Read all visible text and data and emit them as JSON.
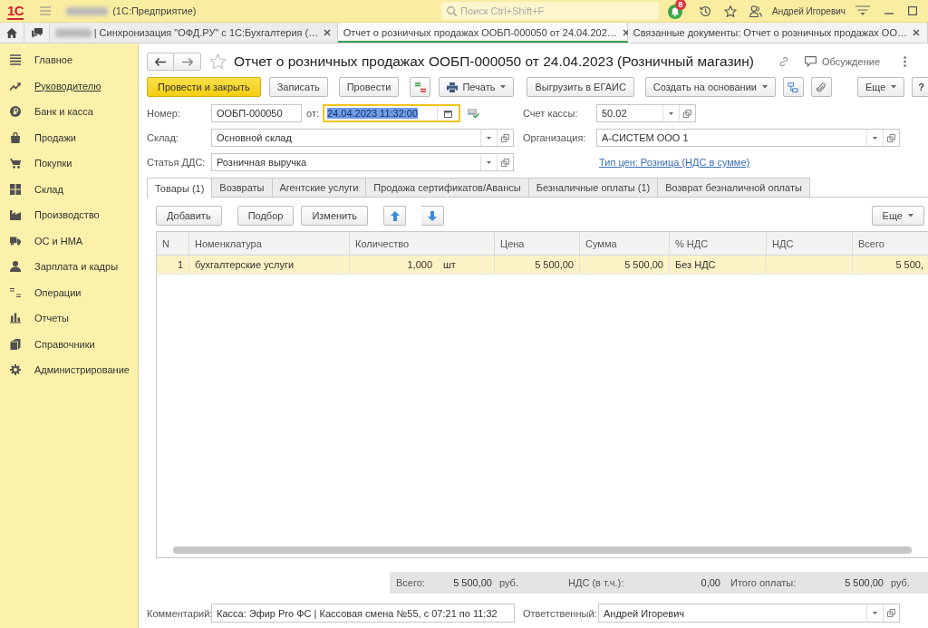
{
  "app_header": {
    "logo": "1С",
    "title_redacted": true,
    "title": "(1С:Предприятие)",
    "search": {
      "placeholder": "Поиск Ctrl+Shift+F"
    },
    "notifications_count": "8",
    "user_name": "Андрей Игоревич"
  },
  "open_tabs": [
    {
      "label": "| Синхронизация \"ОФД.РУ\" с 1С:Бухгалтерия (…",
      "redacted_prefix": true,
      "selected": false
    },
    {
      "label": "Отчет о розничных продажах ООБП-000050 от 24.04.202…",
      "redacted_prefix": false,
      "selected": true
    },
    {
      "label": "Связанные документы: Отчет о розничных продажах ОО…",
      "redacted_prefix": false,
      "selected": false
    }
  ],
  "sidebar": {
    "items": [
      {
        "label": "Главное",
        "hovered": false
      },
      {
        "label": "Руководителю",
        "hovered": true
      },
      {
        "label": "Банк и касса",
        "hovered": false
      },
      {
        "label": "Продажи",
        "hovered": false
      },
      {
        "label": "Покупки",
        "hovered": false
      },
      {
        "label": "Склад",
        "hovered": false
      },
      {
        "label": "Производство",
        "hovered": false
      },
      {
        "label": "ОС и НМА",
        "hovered": false
      },
      {
        "label": "Зарплата и кадры",
        "hovered": false
      },
      {
        "label": "Операции",
        "hovered": false
      },
      {
        "label": "Отчеты",
        "hovered": false
      },
      {
        "label": "Справочники",
        "hovered": false
      },
      {
        "label": "Администрирование",
        "hovered": false
      }
    ]
  },
  "document": {
    "title": "Отчет о розничных продажах ООБП-000050 от 24.04.2023 (Розничный магазин)",
    "discussion": "Обсуждение",
    "toolbar": [
      {
        "kind": "primary",
        "label": "Провести и закрыть"
      },
      {
        "kind": "plain",
        "label": "Записать"
      },
      {
        "kind": "plain",
        "label": "Провести"
      },
      {
        "kind": "ledger"
      },
      {
        "kind": "print",
        "label": "Печать"
      },
      {
        "kind": "plain",
        "label": "Выгрузить в ЕГАИС"
      },
      {
        "kind": "dropdown",
        "label": "Создать на основании"
      },
      {
        "kind": "structure"
      },
      {
        "kind": "attach"
      },
      {
        "kind": "more",
        "label": "Еще"
      },
      {
        "kind": "plain",
        "label": "?"
      }
    ],
    "fields": {
      "number": {
        "label": "Номер:",
        "value": "ООБП-000050"
      },
      "date": {
        "label": "от:",
        "value": "24.04.2023 11:32:00",
        "focused": true
      },
      "cash_account": {
        "label": "Счет кассы:",
        "value": "50.02"
      },
      "warehouse": {
        "label": "Склад:",
        "value": "Основной склад"
      },
      "organization": {
        "label": "Организация:",
        "value": "А-СИСТЕМ ООО 1"
      },
      "cash_flow_item": {
        "label": "Статья ДДС:",
        "value": "Розничная выручка"
      }
    },
    "price_type_link": "Тип цен: Розница (НДС в сумме)"
  },
  "form_tabs": [
    {
      "label": "Товары (1)",
      "selected": true
    },
    {
      "label": "Возвраты",
      "selected": false
    },
    {
      "label": "Агентские услуги",
      "selected": false
    },
    {
      "label": "Продажа сертификатов/Авансы",
      "selected": false
    },
    {
      "label": "Безналичные оплаты (1)",
      "selected": false
    },
    {
      "label": "Возврат безналичной оплаты",
      "selected": false
    }
  ],
  "table_toolbar": {
    "buttons": [
      "Добавить",
      "Подбор",
      "Изменить"
    ],
    "more": "Еще"
  },
  "table": {
    "columns": [
      "N",
      "Номенклатура",
      "Количество",
      "Цена",
      "Сумма",
      "% НДС",
      "НДС",
      "Всего"
    ],
    "rows": [
      {
        "selected": true,
        "n": "1",
        "item": "бухгалтерские услуги",
        "quantity": "1,000",
        "unit": "шт",
        "price": "5 500,00",
        "amount": "5 500,00",
        "vat_rate": "Без НДС",
        "total": "5 500,"
      }
    ]
  },
  "totals": [
    {
      "label": "Всего:",
      "value": "5 500,00",
      "currency": "руб."
    },
    {
      "label": "НДС (в т.ч.):",
      "value": "0,00"
    },
    {
      "label": "Итого оплаты:",
      "value": "5 500,00",
      "currency": "руб."
    }
  ],
  "comment": {
    "label": "Комментарий:",
    "value": "Касса: Эфир Pro ФС | Кассовая смена №55, с 07:21 по 11:32"
  },
  "responsible": {
    "label": "Ответственный:",
    "value": "Андрей Игоревич"
  }
}
